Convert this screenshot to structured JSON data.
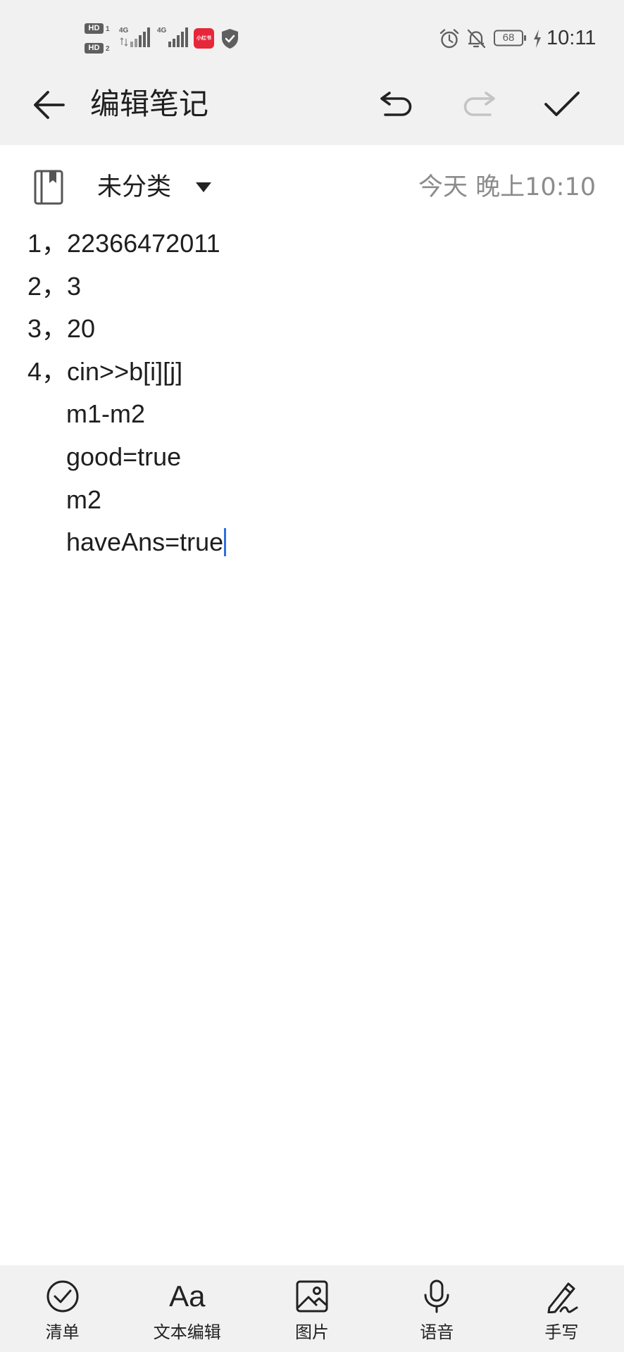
{
  "colors": {
    "header_bg": "#f1f1f1",
    "text": "#1e1e1e",
    "muted": "#8c8c8c",
    "disabled": "#c4c4c4",
    "cursor": "#2f6fdb",
    "app_icon": "#e8263a"
  },
  "status_bar": {
    "sim_slots": [
      {
        "badge": "HD",
        "slot": "1"
      },
      {
        "badge": "HD",
        "slot": "2"
      }
    ],
    "networks": [
      "4G",
      "4G"
    ],
    "app_icon_text": "小红书",
    "battery_level": "68",
    "time": "10:11",
    "icons": [
      "hd-icon",
      "signal-icon",
      "xiaohongshu-app-icon",
      "shield-icon",
      "alarm-icon",
      "bell-off-icon",
      "battery-icon",
      "charging-icon"
    ]
  },
  "toolbar": {
    "title": "编辑笔记",
    "back_icon": "back-arrow-icon",
    "undo_icon": "undo-icon",
    "redo_icon": "redo-icon",
    "done_icon": "check-icon",
    "redo_enabled": false
  },
  "category": {
    "icon": "notebook-icon",
    "label": "未分类",
    "dropdown_icon": "dropdown-triangle-icon",
    "timestamp": "今天 晚上10:10"
  },
  "note": {
    "lines": [
      "1，22366472011",
      "2，3",
      "3，20",
      "4，cin>>b[i][j]",
      "m1-m2",
      "good=true",
      "m2",
      "haveAns=true"
    ]
  },
  "bottom_bar": {
    "items": [
      {
        "label": "清单",
        "icon": "checklist-icon"
      },
      {
        "label": "文本编辑",
        "icon": "text-format-icon",
        "icon_text": "Aa"
      },
      {
        "label": "图片",
        "icon": "image-icon"
      },
      {
        "label": "语音",
        "icon": "microphone-icon"
      },
      {
        "label": "手写",
        "icon": "handwriting-icon"
      }
    ]
  }
}
